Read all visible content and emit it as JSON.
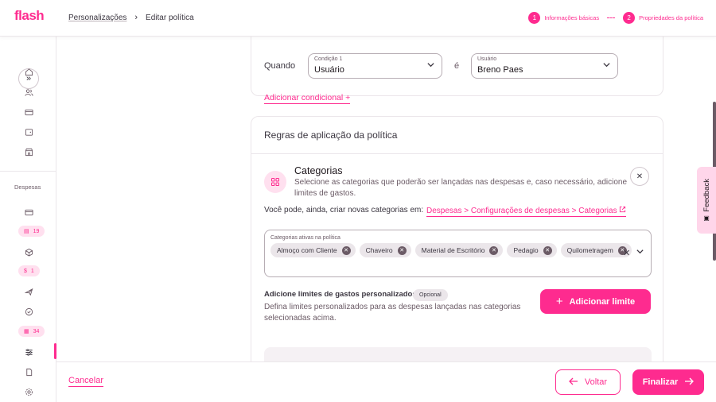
{
  "brand": {
    "logo": "flash",
    "accent_color": "#fe2b8f"
  },
  "breadcrumb": {
    "parent": "Personalizações",
    "separator": "›",
    "current": "Editar política"
  },
  "stepper": {
    "steps": [
      {
        "number": "1",
        "label": "Informações básicas"
      },
      {
        "number": "2",
        "label": "Propriedades da política"
      }
    ]
  },
  "sidebar": {
    "collapse_icon": "»",
    "section_label": "Despesas",
    "badges": [
      {
        "icon": "receipt-icon",
        "count": "19"
      },
      {
        "icon": "dollar-icon",
        "count": "1"
      },
      {
        "icon": "report-icon",
        "count": "34"
      }
    ]
  },
  "condition": {
    "when_label": "Quando",
    "condition_field": {
      "label": "Condição 1",
      "value": "Usuário"
    },
    "equals_label": "é",
    "user_field": {
      "label": "Usuário",
      "value": "Breno Paes"
    },
    "add_condition": "Adicionar condicional"
  },
  "rules": {
    "title": "Regras de aplicação da política",
    "categories_title": "Categorias",
    "categories_desc": "Selecione as categorias que poderão ser lançadas nas despesas e, caso necessário, adicione limites de gastos.",
    "create_text": "Você pode, ainda, criar novas categorias em:",
    "create_link": "Despesas > Configurações de despesas > Categorias",
    "active_label": "Categorias ativas na política",
    "chips": [
      "Almoço com Cliente",
      "Chaveiro",
      "Material de Escritório",
      "Pedagio",
      "Quilometragem"
    ],
    "limits_title": "Adicione limites de gastos personalizados",
    "optional_badge": "Opcional",
    "limits_desc": "Defina limites personalizados para as despesas lançadas nas categorias selecionadas acima.",
    "add_limit_button": "Adicionar limite"
  },
  "feedback": {
    "label": "Feedback"
  },
  "footer": {
    "cancel": "Cancelar",
    "back": "Voltar",
    "finish": "Finalizar"
  }
}
